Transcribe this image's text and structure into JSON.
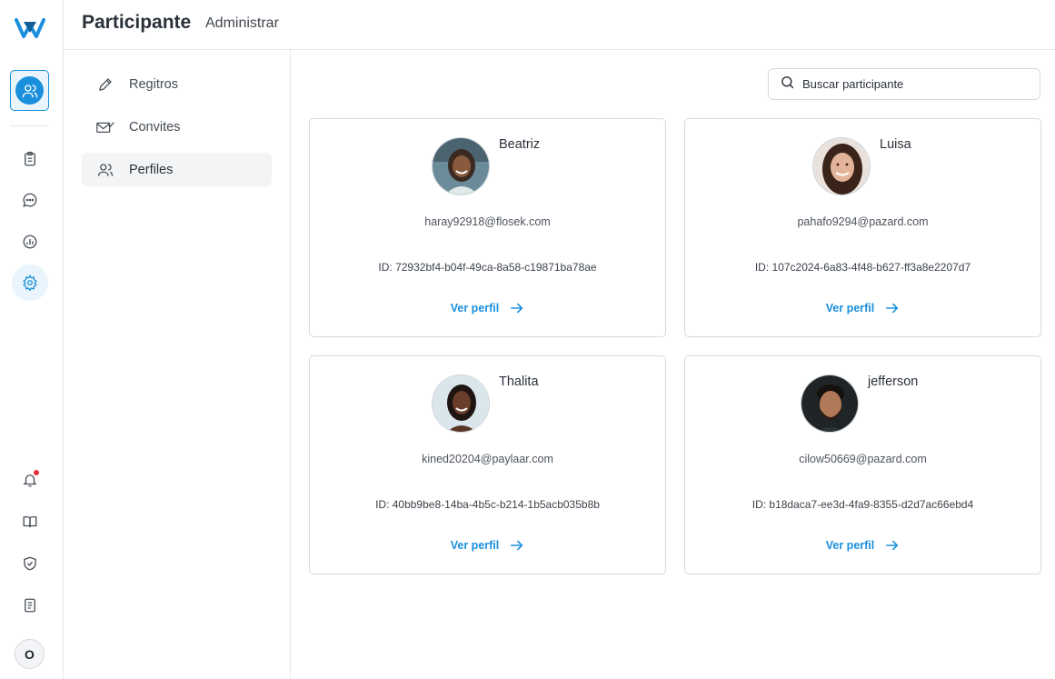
{
  "header": {
    "title": "Participante",
    "subtitle": "Administrar"
  },
  "rail": {
    "icons": [
      "logo-icon",
      "participants-icon",
      "clipboard-icon",
      "chat-icon",
      "analytics-icon",
      "settings-icon",
      "bell-icon",
      "book-icon",
      "shield-check-icon",
      "document-icon"
    ],
    "user_initial": "O",
    "notification_dot": true
  },
  "subnav": {
    "items": [
      {
        "label": "Regitros",
        "icon": "pencil-icon",
        "active": false
      },
      {
        "label": "Convites",
        "icon": "envelope-check-icon",
        "active": false
      },
      {
        "label": "Perfiles",
        "icon": "users-icon",
        "active": true
      }
    ]
  },
  "search": {
    "placeholder": "Buscar participante"
  },
  "participants": [
    {
      "name": "Beatriz",
      "email": "haray92918@flosek.com",
      "id": "ID: 72932bf4-b04f-49ca-8a58-c19871ba78ae",
      "link": "Ver perfil"
    },
    {
      "name": "Luisa",
      "email": "pahafo9294@pazard.com",
      "id": "ID: 107c2024-6a83-4f48-b627-ff3a8e2207d7",
      "link": "Ver perfil"
    },
    {
      "name": "Thalita",
      "email": "kined20204@paylaar.com",
      "id": "ID: 40bb9be8-14ba-4b5c-b214-1b5acb035b8b",
      "link": "Ver perfil"
    },
    {
      "name": "jefferson",
      "email": "cilow50669@pazard.com",
      "id": "ID: b18daca7-ee3d-4fa9-8355-d2d7ac66ebd4",
      "link": "Ver perfil"
    }
  ],
  "colors": {
    "accent": "#1a8fdc",
    "notification": "#e5303a",
    "border": "#d7dbe0"
  }
}
